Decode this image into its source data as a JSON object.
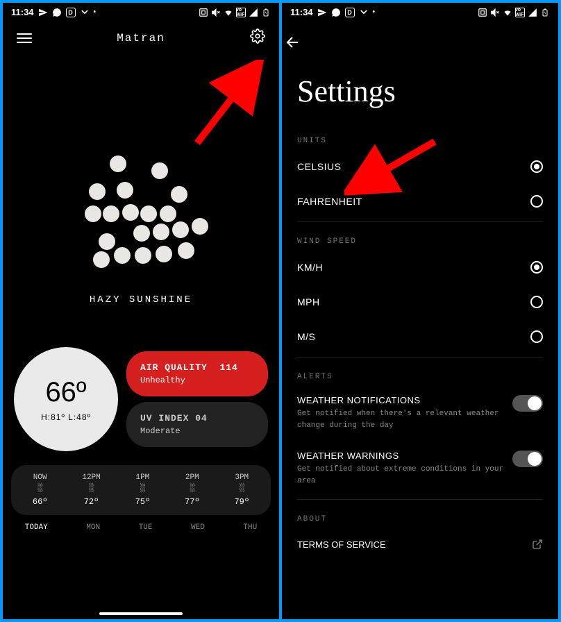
{
  "status": {
    "time": "11:34"
  },
  "screen1": {
    "location": "Matran",
    "condition": "HAZY SUNSHINE",
    "temp": "66º",
    "hilo": "H:81º L:48º",
    "aq": {
      "label": "AIR QUALITY",
      "value": "114",
      "desc": "Unhealthy"
    },
    "uv": {
      "label": "UV INDEX",
      "value": "04",
      "desc": "Moderate"
    },
    "hourly": [
      {
        "label": "NOW",
        "temp": "66º"
      },
      {
        "label": "12PM",
        "temp": "72º"
      },
      {
        "label": "1PM",
        "temp": "75º"
      },
      {
        "label": "2PM",
        "temp": "77º"
      },
      {
        "label": "3PM",
        "temp": "79º"
      }
    ],
    "days": [
      "TODAY",
      "MON",
      "TUE",
      "WED",
      "THU"
    ]
  },
  "screen2": {
    "title": "Settings",
    "sections": {
      "units": {
        "label": "UNITS",
        "options": [
          {
            "label": "CELSIUS",
            "selected": true
          },
          {
            "label": "FAHRENHEIT",
            "selected": false
          }
        ]
      },
      "wind": {
        "label": "WIND SPEED",
        "options": [
          {
            "label": "KM/H",
            "selected": true
          },
          {
            "label": "MPH",
            "selected": false
          },
          {
            "label": "M/S",
            "selected": false
          }
        ]
      },
      "alerts": {
        "label": "ALERTS",
        "items": [
          {
            "title": "WEATHER NOTIFICATIONS",
            "desc": "Get notified when there's a relevant weather change during the day",
            "on": true
          },
          {
            "title": "WEATHER WARNINGS",
            "desc": "Get notified about extreme conditions in your area",
            "on": true
          }
        ]
      },
      "about": {
        "label": "ABOUT",
        "items": [
          {
            "title": "TERMS OF SERVICE"
          }
        ]
      }
    }
  }
}
